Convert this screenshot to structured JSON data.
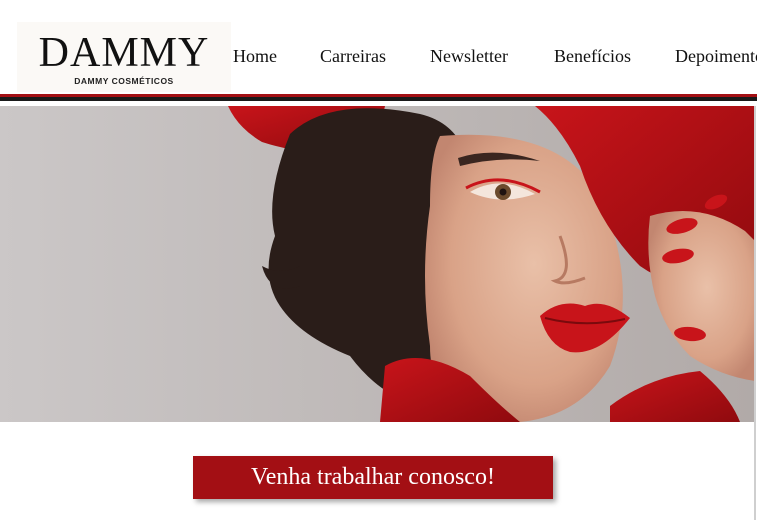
{
  "logo": {
    "title": "DAMMY",
    "subtitle": "DAMMY COSMÉTICOS"
  },
  "nav": {
    "items": [
      {
        "id": "home",
        "label": "Home"
      },
      {
        "id": "carreiras",
        "label": "Carreiras"
      },
      {
        "id": "newsletter",
        "label": "Newsletter"
      },
      {
        "id": "beneficios",
        "label": "Benefícios"
      },
      {
        "id": "depoimentos",
        "label": "Depoimentos"
      }
    ]
  },
  "hero": {
    "image": "woman-red-hat-lipstick-photo"
  },
  "cta": {
    "label": "Venha trabalhar conosco!"
  },
  "colors": {
    "brand_red": "#a30f14",
    "bar_dark": "#1a1a1a",
    "text": "#111111"
  }
}
